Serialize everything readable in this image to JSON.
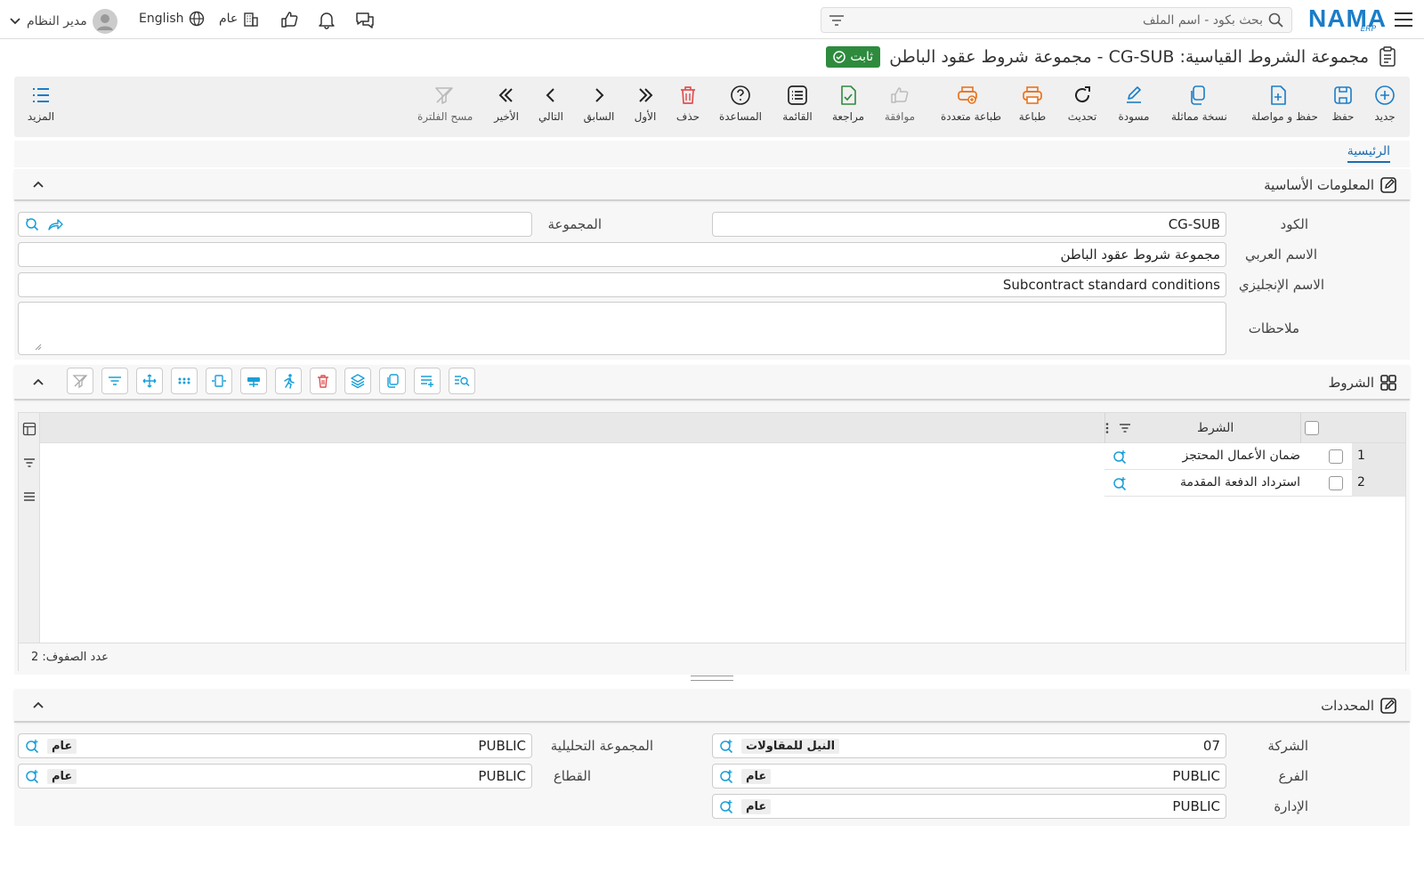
{
  "topbar": {
    "search_placeholder": "بحث بكود - اسم الملف",
    "logo_text": "NAMA",
    "logo_sub": "ERP",
    "user_name": "مدير النظام",
    "language": "English",
    "scope": "عام",
    "icons": [
      "filter-icon",
      "search-icon",
      "menu-icon",
      "chat-icon",
      "bell-icon",
      "thumbs-up-icon",
      "building-icon",
      "globe-icon",
      "user-avatar-icon",
      "chevron-down-icon"
    ]
  },
  "title": {
    "text": "مجموعة الشروط القياسية: CG-SUB - مجموعة شروط عقود الباطن",
    "status": "ثابت"
  },
  "toolbar": {
    "new": "جديد",
    "save": "حفظ",
    "save_continue": "حفظ و مواصلة",
    "duplicate": "نسخة مماثلة",
    "draft": "مسودة",
    "refresh": "تحديث",
    "print": "طباعة",
    "multi_print": "طباعة متعددة",
    "approve": "موافقة",
    "review": "مراجعة",
    "list": "القائمة",
    "help": "المساعدة",
    "delete": "حذف",
    "first": "الأول",
    "previous": "السابق",
    "next": "التالي",
    "last": "الأخير",
    "clear_filter": "مسح الفلترة",
    "more": "المزيد"
  },
  "tabs": {
    "main": "الرئيسية"
  },
  "basic": {
    "header": "المعلومات الأساسية",
    "code_label": "الكود",
    "code_value": "CG-SUB",
    "group_label": "المجموعة",
    "group_value": "",
    "arabic_name_label": "الاسم العربي",
    "arabic_name_value": "مجموعة شروط عقود الباطن",
    "english_name_label": "الاسم الإنجليزي",
    "english_name_value": "Subcontract standard conditions",
    "notes_label": "ملاحظات",
    "notes_value": ""
  },
  "conditions": {
    "header": "الشروط",
    "column_header": "الشرط",
    "rows": [
      {
        "num": "1",
        "text": "ضمان الأعمال المحتجز"
      },
      {
        "num": "2",
        "text": "استرداد الدفعة المقدمة"
      }
    ],
    "row_count": "عدد الصفوف: 2"
  },
  "dimensions": {
    "header": "المحددات",
    "company_label": "الشركة",
    "company_code": "07",
    "company_name": "النيل للمقاولات",
    "branch_label": "الفرع",
    "branch_code": "PUBLIC",
    "branch_name": "عام",
    "department_label": "الإدارة",
    "department_code": "PUBLIC",
    "department_name": "عام",
    "analysis_label": "المجموعة التحليلية",
    "analysis_code": "PUBLIC",
    "analysis_name": "عام",
    "sector_label": "القطاع",
    "sector_code": "PUBLIC",
    "sector_name": "عام"
  },
  "colors": {
    "accent": "#1a7dc8",
    "status_green": "#2e8b3e",
    "danger": "#e05050",
    "print_orange": "#e8741e"
  }
}
